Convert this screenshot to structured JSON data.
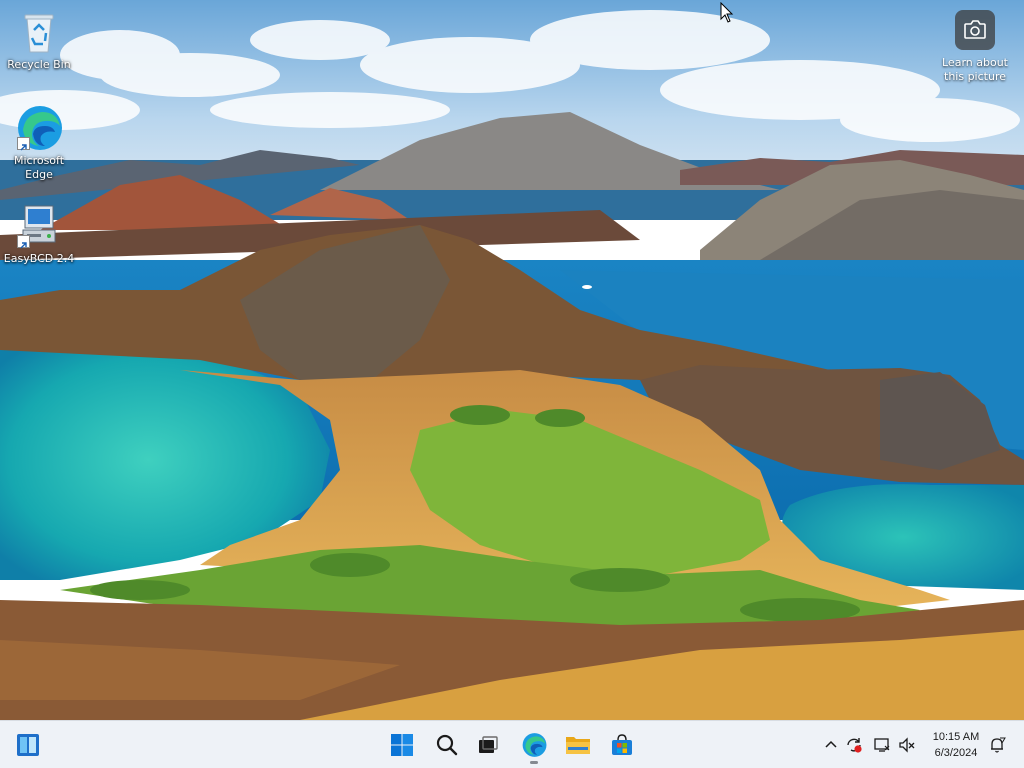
{
  "desktop": {
    "icons": [
      {
        "label": "Recycle Bin"
      },
      {
        "label": "Microsoft Edge"
      },
      {
        "label": "EasyBCD 2.4"
      }
    ],
    "spotlight": {
      "label": "Learn about this picture",
      "icon": "camera-icon"
    }
  },
  "taskbar": {
    "widgets_icon": "widgets-icon",
    "pinned": [
      {
        "name": "Start",
        "icon": "windows-logo-icon"
      },
      {
        "name": "Search",
        "icon": "search-icon"
      },
      {
        "name": "Task View",
        "icon": "task-view-icon"
      },
      {
        "name": "Microsoft Edge",
        "icon": "edge-icon",
        "active": true
      },
      {
        "name": "File Explorer",
        "icon": "folder-icon"
      },
      {
        "name": "Microsoft Store",
        "icon": "store-icon"
      }
    ],
    "tray": {
      "icons": [
        "chevron-up-icon",
        "sync-alert-icon",
        "display-icon",
        "speaker-muted-icon"
      ],
      "time": "10:15 AM",
      "date": "6/3/2024",
      "notification_icon": "notification-bell-icon"
    }
  },
  "colors": {
    "accent": "#0067c0",
    "taskbar_bg": "#eef2f7",
    "sky": "#8fc1e8",
    "ocean": "#1d8fc7",
    "lagoon": "#19b0b0"
  }
}
